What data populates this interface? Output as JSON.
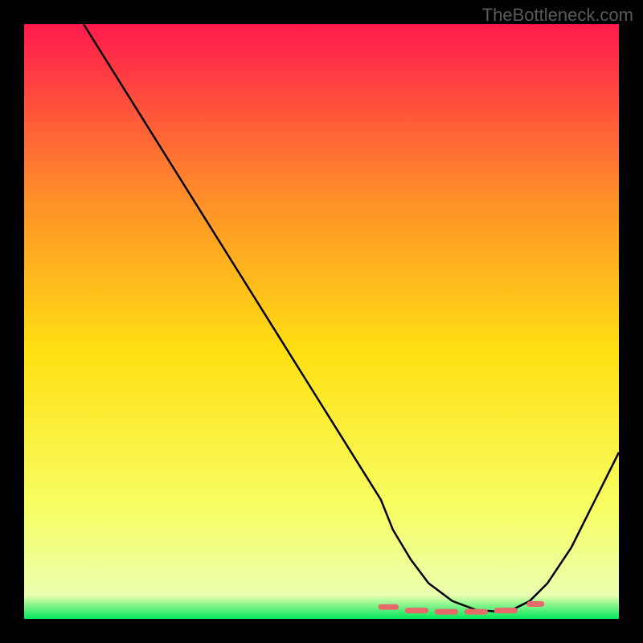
{
  "watermark": "TheBottleneck.com",
  "chart_data": {
    "type": "line",
    "title": "",
    "xlabel": "",
    "ylabel": "",
    "xlim": [
      0,
      100
    ],
    "ylim": [
      0,
      100
    ],
    "background_gradient": {
      "top": "#ff1a4d",
      "mid_upper": "#ff8a2a",
      "mid": "#ffe012",
      "mid_lower": "#f7ff66",
      "bottom": "#00e85a"
    },
    "series": [
      {
        "name": "bottleneck-curve",
        "x": [
          10,
          15,
          20,
          25,
          30,
          35,
          40,
          45,
          50,
          55,
          60,
          62,
          65,
          68,
          72,
          76,
          80,
          82,
          85,
          88,
          92,
          96,
          100
        ],
        "y": [
          100,
          92,
          84,
          76,
          68,
          60,
          52,
          44,
          36,
          28,
          20,
          15,
          10,
          6,
          3,
          1.5,
          1.2,
          1.5,
          3,
          6,
          12,
          20,
          28
        ],
        "color": "#000000"
      }
    ],
    "markers": {
      "name": "bottom-dashes",
      "color": "#e66a6a",
      "segments": [
        {
          "x1": 60,
          "x2": 62.5,
          "y": 2.0
        },
        {
          "x1": 64.5,
          "x2": 67.5,
          "y": 1.4
        },
        {
          "x1": 69.5,
          "x2": 72.5,
          "y": 1.2
        },
        {
          "x1": 74.5,
          "x2": 77.5,
          "y": 1.2
        },
        {
          "x1": 79.5,
          "x2": 82.5,
          "y": 1.4
        },
        {
          "x1": 85.0,
          "x2": 87.0,
          "y": 2.5
        }
      ]
    }
  }
}
